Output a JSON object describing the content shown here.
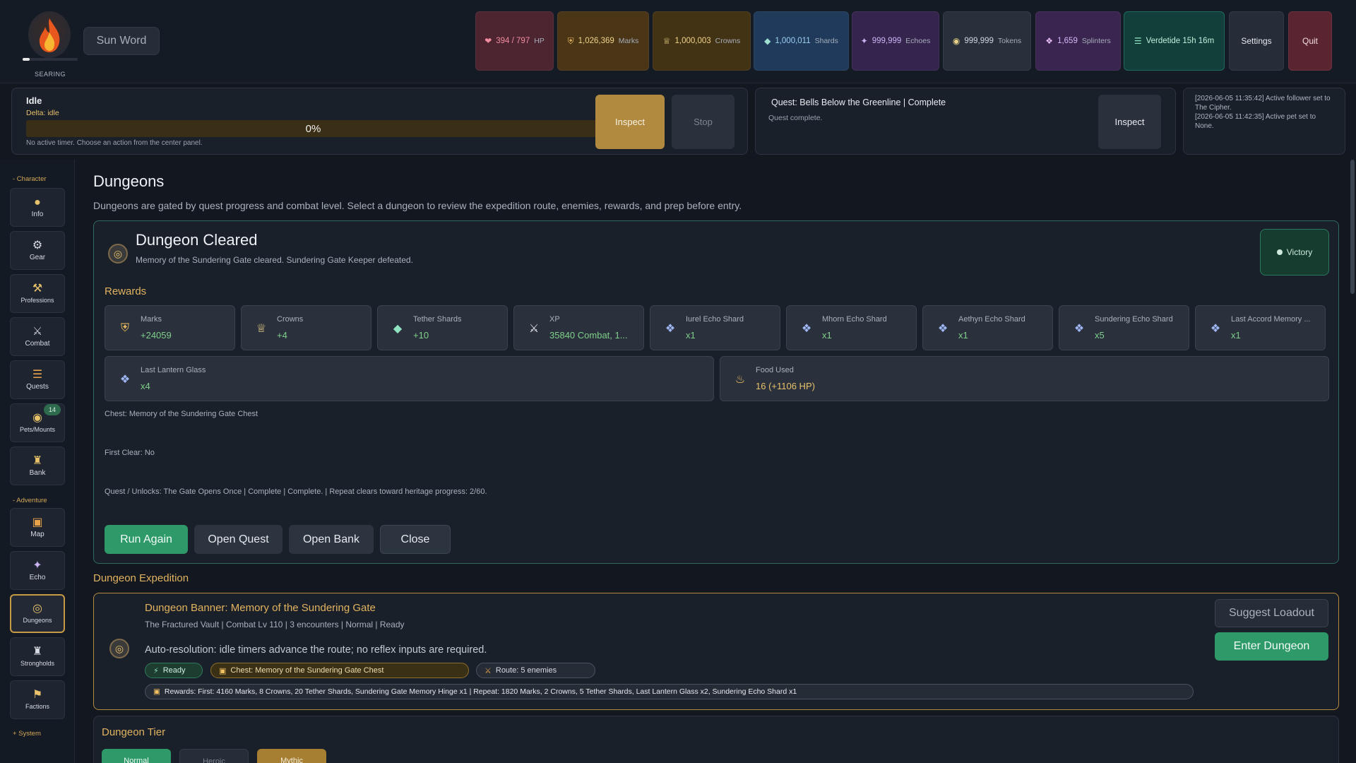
{
  "header": {
    "avatar_caption": "SEARING",
    "sun_word_label": "Sun Word",
    "stats": {
      "hp": {
        "value": "394 / 797",
        "unit": "HP",
        "icon": "heart-icon"
      },
      "marks": {
        "value": "1,026,369",
        "unit": "Marks",
        "icon": "shield-icon"
      },
      "crowns": {
        "value": "1,000,003",
        "unit": "Crowns",
        "icon": "crown-icon"
      },
      "shards": {
        "value": "1,000,011",
        "unit": "Shards",
        "icon": "diamond-icon"
      },
      "echoes": {
        "value": "999,999",
        "unit": "Echoes",
        "icon": "sparkle-icon"
      },
      "tokens": {
        "value": "999,999",
        "unit": "Tokens",
        "icon": "token-icon"
      },
      "splinters": {
        "value": "1,659",
        "unit": "Splinters",
        "icon": "splinter-icon"
      },
      "verdetide": {
        "value": "Verdetide 15h 16m",
        "icon": "wave-icon"
      }
    },
    "settings_label": "Settings",
    "quit_label": "Quit"
  },
  "idle": {
    "title": "Idle",
    "delta": "Delta: idle",
    "progress_pct": 0,
    "progress_label": "0%",
    "hint": "No active timer. Choose an action from the center panel.",
    "inspect_label": "Inspect",
    "stop_label": "Stop"
  },
  "quest": {
    "title": "Quest: Bells Below the Greenline | Complete",
    "subtitle": "Quest complete.",
    "inspect_label": "Inspect"
  },
  "log": {
    "lines": [
      "[2026-06-05 11:35:42] Active follower set to The Cipher.",
      "[2026-06-05 11:42:35] Active pet set to None."
    ]
  },
  "sidebar": {
    "character_group": "- Character",
    "adventure_group": "- Adventure",
    "system_group": "+ System",
    "items": [
      {
        "label": "Info",
        "icon": "info-icon"
      },
      {
        "label": "Gear",
        "icon": "gear-icon"
      },
      {
        "label": "Professions",
        "icon": "professions-icon"
      },
      {
        "label": "Combat",
        "icon": "crossed-swords-icon"
      },
      {
        "label": "Quests",
        "icon": "scroll-icon"
      },
      {
        "label": "Pets/Mounts",
        "icon": "pet-icon",
        "badge": "14"
      },
      {
        "label": "Bank",
        "icon": "bank-icon"
      },
      {
        "label": "Map",
        "icon": "map-icon"
      },
      {
        "label": "Echo",
        "icon": "echo-icon"
      },
      {
        "label": "Dungeons",
        "icon": "dungeon-icon",
        "active": true
      },
      {
        "label": "Strongholds",
        "icon": "stronghold-icon"
      },
      {
        "label": "Factions",
        "icon": "flag-icon"
      }
    ]
  },
  "main": {
    "title": "Dungeons",
    "description": "Dungeons are gated by quest progress and combat level. Select a dungeon to review the expedition route, enemies, rewards, and prep before entry."
  },
  "cleared": {
    "title": "Dungeon Cleared",
    "subtitle": "Memory of the Sundering Gate cleared. Sundering Gate Keeper defeated.",
    "victory_label": "Victory",
    "rewards_heading": "Rewards",
    "rewards": [
      {
        "name": "Marks",
        "value": "+24059",
        "icon": "marks-icon"
      },
      {
        "name": "Crowns",
        "value": "+4",
        "icon": "crown-icon"
      },
      {
        "name": "Tether Shards",
        "value": "+10",
        "icon": "tether-shard-icon"
      },
      {
        "name": "XP",
        "value": "35840 Combat, 1...",
        "icon": "xp-swords-icon"
      },
      {
        "name": "Iurel Echo Shard",
        "value": "x1",
        "icon": "crystal-icon"
      },
      {
        "name": "Mhorn Echo Shard",
        "value": "x1",
        "icon": "crystal-icon"
      },
      {
        "name": "Aethyn Echo Shard",
        "value": "x1",
        "icon": "crystal-icon"
      },
      {
        "name": "Sundering Echo Shard",
        "value": "x5",
        "icon": "crystal-icon"
      },
      {
        "name": "Last Accord Memory ...",
        "value": "x1",
        "icon": "crystal-icon"
      },
      {
        "name": "Last Lantern Glass",
        "value": "x4",
        "icon": "crystal-icon"
      },
      {
        "name": "Food Used",
        "value": "16 (+1106 HP)",
        "icon": "food-icon"
      }
    ],
    "chest_line": "Chest: Memory of the Sundering Gate Chest",
    "first_clear_line": "First Clear: No",
    "unlocks_line": "Quest / Unlocks: The Gate Opens Once | Complete | Complete. | Repeat clears toward heritage progress: 2/60.",
    "buttons": {
      "run_again": "Run Again",
      "open_quest": "Open Quest",
      "open_bank": "Open Bank",
      "close": "Close"
    }
  },
  "expedition": {
    "heading": "Dungeon Expedition",
    "title": "Dungeon Banner: Memory of the Sundering Gate",
    "meta": "The Fractured Vault | Combat Lv 110 | 3 encounters | Normal | Ready",
    "auto_text": "Auto-resolution: idle timers advance the route; no reflex inputs are required.",
    "chip_ready": "Ready",
    "chip_chest": "Chest: Memory of the Sundering Gate Chest",
    "chip_route": "Route: 5 enemies",
    "chip_rewards": "Rewards: First: 4160 Marks, 8 Crowns, 20 Tether Shards, Sundering Gate Memory Hinge x1 | Repeat: 1820 Marks, 2 Crowns, 5 Tether Shards, Last Lantern Glass x2, Sundering Echo Shard x1",
    "suggest_label": "Suggest Loadout",
    "enter_label": "Enter Dungeon"
  },
  "tier": {
    "heading": "Dungeon Tier",
    "options": [
      "Normal",
      "Heroic",
      "Mythic"
    ],
    "selected": "Normal"
  },
  "colors": {
    "accent_gold": "#e2b35f",
    "success_green": "#2e9a6a",
    "background": "#121720"
  }
}
